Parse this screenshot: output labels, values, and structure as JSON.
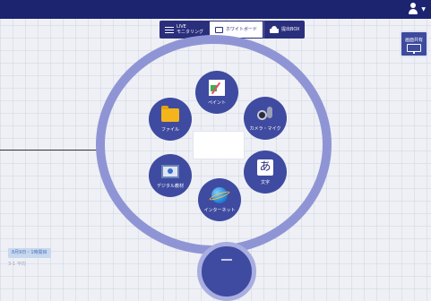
{
  "tabs": [
    {
      "label": "LIVE\nモニタリング",
      "icon": "monitoring-icon"
    },
    {
      "label": "ホワイトボード",
      "icon": "whiteboard-icon"
    },
    {
      "label": "提出BOX",
      "icon": "submit-box-icon"
    }
  ],
  "share_button": {
    "label": "画面共有",
    "icon": "screen-share-icon"
  },
  "tools": {
    "paint": {
      "label": "ペイント",
      "icon": "paint-icon"
    },
    "file": {
      "label": "ファイル",
      "icon": "folder-icon"
    },
    "camera": {
      "label": "カメラ・マイク",
      "icon": "camera-mic-icon"
    },
    "text": {
      "label": "文字",
      "glyph": "あ",
      "icon": "text-icon"
    },
    "digital": {
      "label": "デジタル教材",
      "icon": "digital-material-icon"
    },
    "internet": {
      "label": "インターネット",
      "icon": "globe-icon"
    }
  },
  "date_badge": "8月9日・1時間目",
  "sub_text": "3-1  平均",
  "colors": {
    "topbar": "#1c2470",
    "tool_bg": "#3f4ba0",
    "ring": "#8f95d4",
    "accent_text": "#4a70b8"
  }
}
